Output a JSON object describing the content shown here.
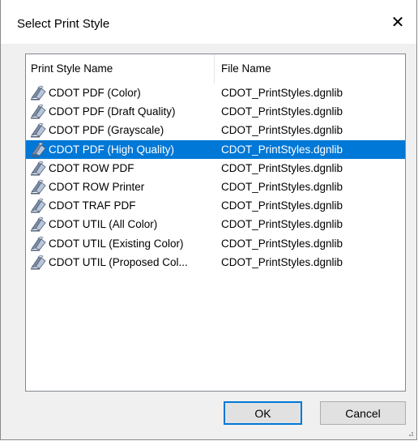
{
  "dialog": {
    "title": "Select Print Style",
    "close_glyph": "✕"
  },
  "list": {
    "columns": [
      "Print Style Name",
      "File Name"
    ],
    "rows": [
      {
        "name": "CDOT PDF (Color)",
        "file": "CDOT_PrintStyles.dgnlib",
        "selected": false
      },
      {
        "name": "CDOT PDF (Draft Quality)",
        "file": "CDOT_PrintStyles.dgnlib",
        "selected": false
      },
      {
        "name": "CDOT PDF (Grayscale)",
        "file": "CDOT_PrintStyles.dgnlib",
        "selected": false
      },
      {
        "name": "CDOT PDF (High Quality)",
        "file": "CDOT_PrintStyles.dgnlib",
        "selected": true
      },
      {
        "name": "CDOT ROW PDF",
        "file": "CDOT_PrintStyles.dgnlib",
        "selected": false
      },
      {
        "name": "CDOT ROW Printer",
        "file": "CDOT_PrintStyles.dgnlib",
        "selected": false
      },
      {
        "name": "CDOT TRAF PDF",
        "file": "CDOT_PrintStyles.dgnlib",
        "selected": false
      },
      {
        "name": "CDOT UTIL (All Color)",
        "file": "CDOT_PrintStyles.dgnlib",
        "selected": false
      },
      {
        "name": "CDOT UTIL (Existing Color)",
        "file": "CDOT_PrintStyles.dgnlib",
        "selected": false
      },
      {
        "name": "CDOT UTIL (Proposed Col...",
        "file": "CDOT_PrintStyles.dgnlib",
        "selected": false
      }
    ],
    "row_icon": "print-style-icon",
    "selection_color": "#0078d7"
  },
  "buttons": {
    "ok": "OK",
    "cancel": "Cancel"
  }
}
